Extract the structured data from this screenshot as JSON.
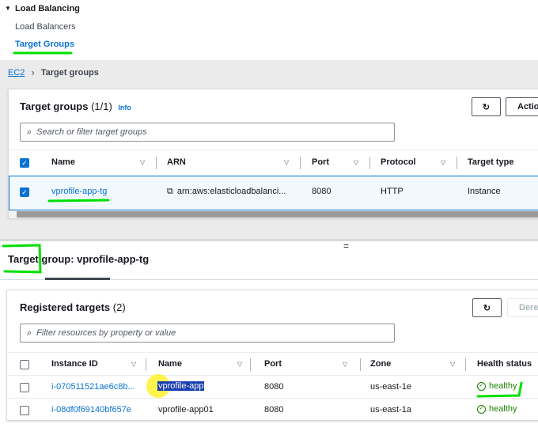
{
  "sidebar": {
    "section": "Load Balancing",
    "items": [
      {
        "label": "Load Balancers"
      },
      {
        "label": "Target Groups"
      }
    ]
  },
  "breadcrumb": {
    "root": "EC2",
    "current": "Target groups"
  },
  "target_groups": {
    "title": "Target groups",
    "count": "(1/1)",
    "info": "Info",
    "actions": "Actions",
    "search_placeholder": "Search or filter target groups",
    "columns": [
      "Name",
      "ARN",
      "Port",
      "Protocol",
      "Target type"
    ],
    "rows": [
      {
        "name": "vprofile-app-tg",
        "arn": "arn:aws:elasticloadbalanci...",
        "port": "8080",
        "protocol": "HTTP",
        "target_type": "Instance"
      }
    ]
  },
  "details": {
    "title": "Target group: vprofile-app-tg"
  },
  "registered": {
    "title": "Registered targets",
    "count": "(2)",
    "deregister": "Dere",
    "search_placeholder": "Filter resources by property or value",
    "columns": [
      "Instance ID",
      "Name",
      "Port",
      "Zone",
      "Health status"
    ],
    "rows": [
      {
        "id": "i-070511521ae6c8b...",
        "name": "vprofile-app",
        "port": "8080",
        "zone": "us-east-1e",
        "health": "healthy"
      },
      {
        "id": "i-08df0f69140bf657e",
        "name": "vprofile-app01",
        "port": "8080",
        "zone": "us-east-1a",
        "health": "healthy"
      }
    ]
  },
  "colors": {
    "link": "#0972d3",
    "healthy": "#1d8102",
    "annotation": "#00e000"
  }
}
